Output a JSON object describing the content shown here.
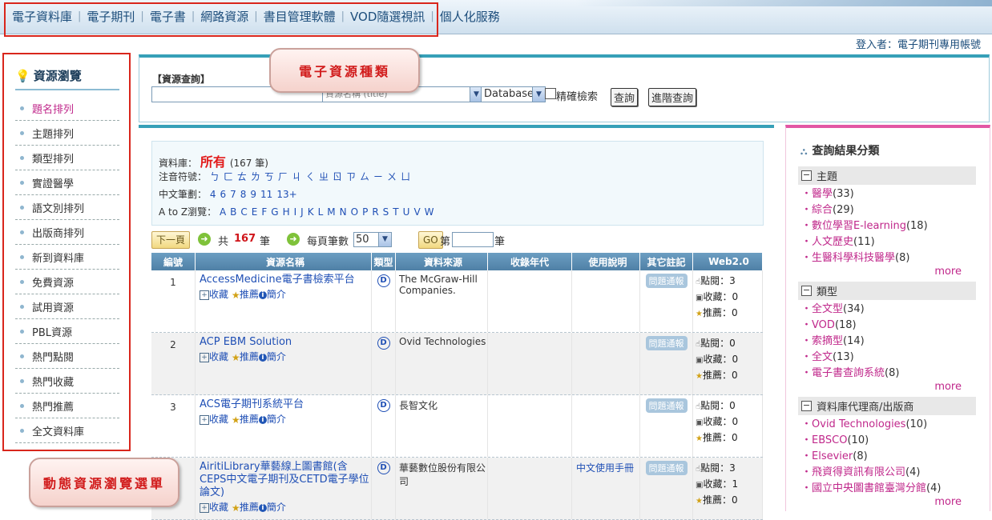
{
  "top_nav": {
    "items": [
      "電子資料庫",
      "電子期刊",
      "電子書",
      "網路資源",
      "書目管理軟體",
      "VOD隨選視訊",
      "個人化服務"
    ],
    "login": "登入者：電子期刊專用帳號"
  },
  "callouts": {
    "resource_types": "電子資源種類",
    "browse_menu": "動態資源瀏覽選單"
  },
  "left_panel": {
    "title": "資源瀏覽",
    "items": [
      "題名排列",
      "主題排列",
      "類型排列",
      "實證醫學",
      "語文別排列",
      "出版商排列",
      "新到資料庫",
      "免費資源",
      "試用資源",
      "PBL資源",
      "熱門點閱",
      "熱門收藏",
      "熱門推薦",
      "全文資料庫"
    ]
  },
  "search": {
    "label": "【資源查詢】",
    "input_value": "",
    "field_select": "資源名稱 (title)",
    "type_select": "Database",
    "exact_label": "精確檢索",
    "search_button": "查詢",
    "advanced_button": "進階查詢"
  },
  "filter": {
    "db_label": "資料庫：",
    "db_all": "所有",
    "db_count": "(167 筆)",
    "zhuyin_label": "注音符號：",
    "zhuyin": [
      "ㄅ",
      "ㄈ",
      "ㄊ",
      "ㄌ",
      "ㄎ",
      "ㄏ",
      "ㄐ",
      "ㄑ",
      "ㄓ",
      "ㄖ",
      "ㄗ",
      "ㄙ",
      "ㄧ",
      "ㄨ",
      "ㄩ"
    ],
    "strokes_label": "中文筆劃：",
    "strokes": [
      "4",
      "6",
      "7",
      "8",
      "9",
      "11",
      "13+"
    ],
    "az_label": "A to Z瀏覽：",
    "az": [
      "A",
      "B",
      "C",
      "E",
      "F",
      "G",
      "H",
      "I",
      "J",
      "K",
      "L",
      "M",
      "N",
      "O",
      "P",
      "R",
      "S",
      "T",
      "U",
      "V",
      "W"
    ]
  },
  "pager": {
    "next": "下一頁",
    "total_prefix": "共",
    "total": "167",
    "total_suffix": "筆",
    "per_page_label": "每頁筆數",
    "per_page": "50",
    "go": "GO",
    "page_prefix": "第",
    "page_suffix": "筆"
  },
  "table": {
    "headers": [
      "編號",
      "資源名稱",
      "類型",
      "資料來源",
      "收錄年代",
      "使用說明",
      "其它註記",
      "Web2.0"
    ],
    "action_labels": {
      "collect": "收藏",
      "recommend": "推薦",
      "intro": "簡介"
    },
    "report_label": "問題通報",
    "stat_labels": {
      "views": "點閱：",
      "collects": "收藏：",
      "recs": "推薦："
    },
    "rows": [
      {
        "num": "1",
        "name": "AccessMedicine電子書檢索平台",
        "type": "D",
        "source": "The McGraw-Hill Companies.",
        "usage": "",
        "views": "3",
        "collects": "0",
        "recs": "0"
      },
      {
        "num": "2",
        "name": "ACP EBM Solution",
        "type": "D",
        "source": "Ovid Technologies",
        "usage": "",
        "views": "0",
        "collects": "0",
        "recs": "0"
      },
      {
        "num": "3",
        "name": "ACS電子期刊系統平台",
        "type": "D",
        "source": "長智文化",
        "usage": "",
        "views": "0",
        "collects": "0",
        "recs": "0"
      },
      {
        "num": "4",
        "name": "AiritiLibrary華藝線上圖書館(含CEPS中文電子期刊及CETD電子學位論文)",
        "type": "D",
        "source": "華藝數位股份有限公司",
        "usage": "中文使用手冊",
        "views": "3",
        "collects": "1",
        "recs": "0"
      }
    ]
  },
  "right_panel": {
    "title": "查詢結果分類",
    "more": "more",
    "groups": [
      {
        "title": "主題",
        "items": [
          {
            "label": "醫學",
            "count": "(33)"
          },
          {
            "label": "綜合",
            "count": "(29)"
          },
          {
            "label": "數位學習E-learning",
            "count": "(18)"
          },
          {
            "label": "人文歷史",
            "count": "(11)"
          },
          {
            "label": "生醫科學科技醫學",
            "count": "(8)"
          }
        ]
      },
      {
        "title": "類型",
        "items": [
          {
            "label": "全文型",
            "count": "(34)"
          },
          {
            "label": "VOD",
            "count": "(18)"
          },
          {
            "label": "索摘型",
            "count": "(14)"
          },
          {
            "label": "全文",
            "count": "(13)"
          },
          {
            "label": "電子書查詢系統",
            "count": "(8)"
          }
        ]
      },
      {
        "title": "資料庫代理商/出版商",
        "items": [
          {
            "label": "Ovid Technologies",
            "count": "(10)"
          },
          {
            "label": "EBSCO",
            "count": "(10)"
          },
          {
            "label": "Elsevier",
            "count": "(8)"
          },
          {
            "label": "飛資得資訊有限公司",
            "count": "(4)"
          },
          {
            "label": "國立中央圖書館臺灣分館",
            "count": "(4)"
          }
        ]
      }
    ]
  }
}
